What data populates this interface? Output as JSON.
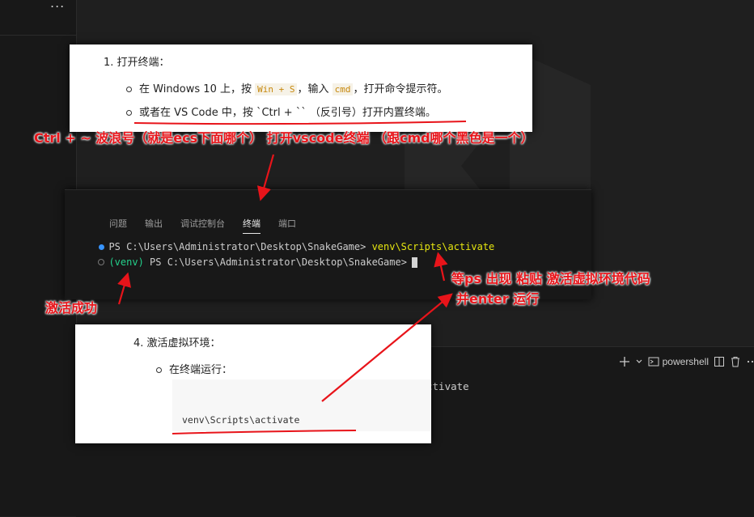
{
  "sidebar": {
    "more_label": "..."
  },
  "snippet1": {
    "heading": "1. 打开终端：",
    "bullet1_pre": "在 Windows 10 上，按 ",
    "bullet1_key": "Win + S",
    "bullet1_mid": "，输入 ",
    "bullet1_cmd": "cmd",
    "bullet1_post": "，打开命令提示符。",
    "bullet2": "或者在 VS Code 中，按 `Ctrl + `` （反引号）打开内置终端。"
  },
  "terminal": {
    "tabs": [
      "问题",
      "输出",
      "调试控制台",
      "终端",
      "端口"
    ],
    "active_tab": "终端",
    "line1_prompt": "PS C:\\Users\\Administrator\\Desktop\\SnakeGame> ",
    "line1_cmd": "venv\\Scripts\\activate",
    "line2_venv": "(venv)",
    "line2_prompt": " PS C:\\Users\\Administrator\\Desktop\\SnakeGame>"
  },
  "snippet3": {
    "heading": "4. 激活虚拟环境：",
    "bullet1": "在终端运行：",
    "code": "venv\\Scripts\\activate"
  },
  "panel": {
    "shell_label": "powershell",
    "behind_text": "ctivate"
  },
  "annotations": {
    "a1": "Ctrl + ~ 波浪号（就是ecs下面哪个） 打开vscode终端 （跟cmd哪个黑色是一个）",
    "a2": "激活成功",
    "a3": "等ps 出现 粘贴 激活虚拟环境代码",
    "a4": "并enter 运行"
  },
  "colors": {
    "annotation_red": "#e8141a",
    "editor_bg": "#1f1f1f",
    "terminal_bg": "#181818",
    "cmd_yellow": "#e5e510",
    "venv_green": "#23d18b",
    "dot_blue": "#3794ff"
  }
}
